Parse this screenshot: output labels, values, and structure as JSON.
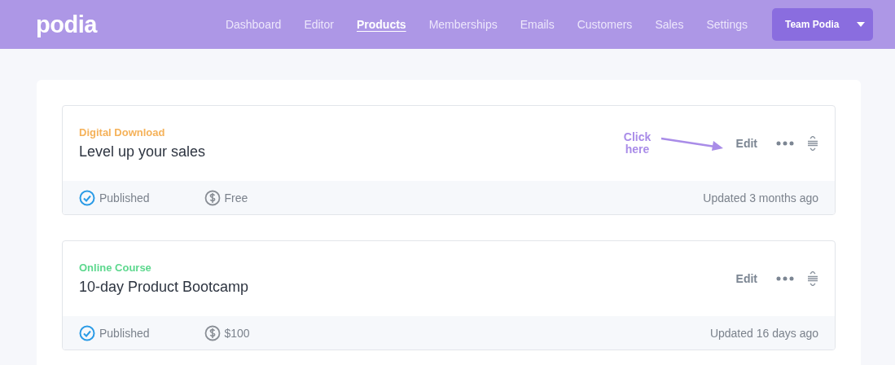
{
  "header": {
    "logo": "podia",
    "nav": [
      {
        "label": "Dashboard",
        "selected": false
      },
      {
        "label": "Editor",
        "selected": false
      },
      {
        "label": "Products",
        "selected": true
      },
      {
        "label": "Memberships",
        "selected": false
      },
      {
        "label": "Emails",
        "selected": false
      },
      {
        "label": "Customers",
        "selected": false
      },
      {
        "label": "Sales",
        "selected": false
      },
      {
        "label": "Settings",
        "selected": false
      }
    ],
    "account_button": "Team Podia"
  },
  "products": [
    {
      "type": "Digital Download",
      "color": "#f5b25a",
      "title": "Level up your sales",
      "annotation": "Click here",
      "edit": "Edit",
      "status": "Published",
      "price": "Free",
      "updated": "Updated 3 months ago"
    },
    {
      "type": "Online Course",
      "color": "#5dd88e",
      "title": "10-day Product Bootcamp",
      "edit": "Edit",
      "status": "Published",
      "price": "$100",
      "updated": "Updated 16 days ago"
    }
  ]
}
